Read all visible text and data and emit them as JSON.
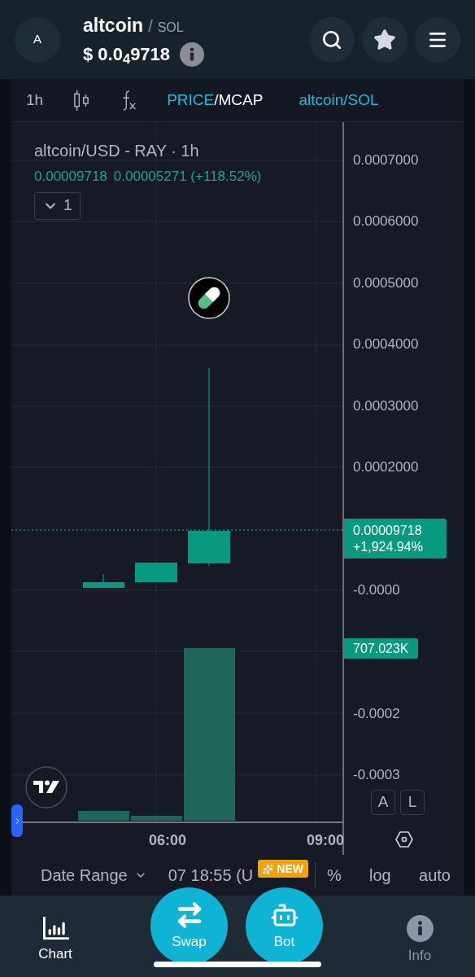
{
  "header": {
    "avatar": "A",
    "token": "altcoin",
    "pair_separator": "/",
    "quote": "SOL",
    "price": "$ 0.0$_{4}$9718"
  },
  "toolbar": {
    "interval": "1h",
    "price_mode": [
      {
        "label": "PRICE",
        "selected": true
      },
      {
        "label": "MCAP",
        "selected": false
      }
    ],
    "mode_separator": "/",
    "pair": "altcoin/SOL"
  },
  "chart": {
    "title": "altcoin/USD - RAY · 1h",
    "last_price": "0.00009718",
    "change": "0.00005271 (+118.52%)",
    "indicators_toggle": "1",
    "y_labels": [
      "0.0007000",
      "0.0006000",
      "0.0005000",
      "0.0004000",
      "0.0003000",
      "0.0002000",
      "-0.0000",
      "-0.0002",
      "-0.0003"
    ],
    "price_tag": {
      "price": "0.00009718",
      "change": "+1,924.94%"
    },
    "volume_tag": "707.023K",
    "scale_buttons": [
      "A",
      "L"
    ],
    "x_labels": [
      "06:00",
      "09:00"
    ]
  },
  "footer_bar": {
    "date_range": "Date Range",
    "timestamp": "07 18:55 (U",
    "badge": "NEW",
    "options": [
      "%",
      "log",
      "auto"
    ]
  },
  "bottom_nav": [
    {
      "label": "Chart",
      "kind": "tab",
      "selected": true
    },
    {
      "label": "Swap",
      "kind": "action"
    },
    {
      "label": "Bot",
      "kind": "action"
    },
    {
      "label": "Info",
      "kind": "tab",
      "selected": false
    }
  ]
}
